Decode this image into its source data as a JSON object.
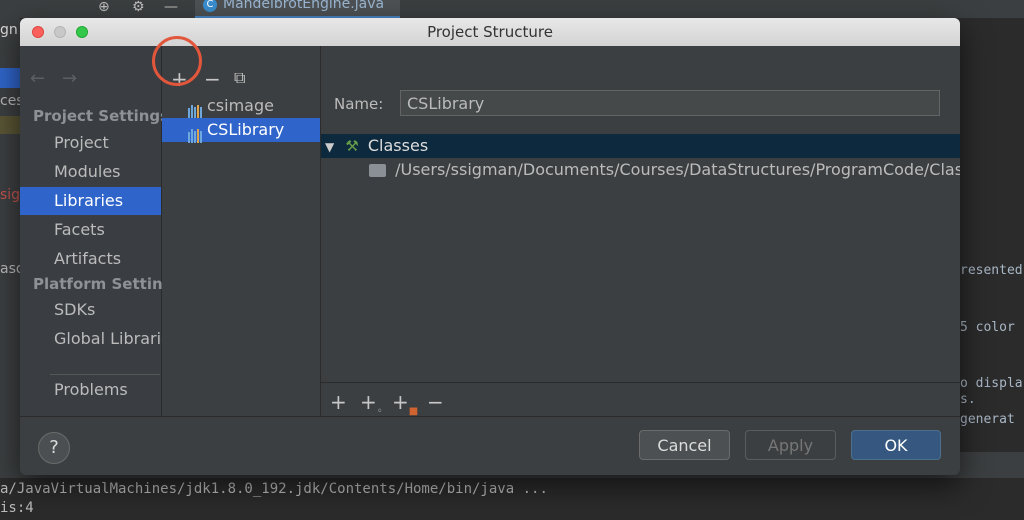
{
  "ide": {
    "editor_tab": "MandelbrotEngine.java",
    "editor_tab_icon": "C",
    "left_fragments": [
      "gn",
      "ces",
      "sig",
      "aso"
    ],
    "right_fragments": [
      "resented",
      "5 color",
      "o displa",
      "s.",
      "generat"
    ],
    "console_line1": "a/JavaVirtualMachines/jdk1.8.0_192.jdk/Contents/Home/bin/java ...",
    "console_line2": "is:4"
  },
  "dialog": {
    "title": "Project Structure",
    "sidebar": {
      "project_settings_heading": "Project Settings",
      "project_settings_items": [
        "Project",
        "Modules",
        "Libraries",
        "Facets",
        "Artifacts"
      ],
      "platform_settings_heading": "Platform Settings",
      "platform_settings_items": [
        "SDKs",
        "Global Libraries"
      ],
      "problems": "Problems",
      "selected": "Libraries"
    },
    "libraries": [
      {
        "name": "csimage",
        "selected": false
      },
      {
        "name": "CSLibrary",
        "selected": true
      }
    ],
    "toolbar_icons": [
      "plus-icon",
      "minus-icon",
      "copy-icon"
    ],
    "name_label": "Name:",
    "name_value": "CSLibrary",
    "tree": {
      "root": "Classes",
      "child": "/Users/ssigman/Documents/Courses/DataStructures/ProgramCode/ClassCode"
    },
    "content_tools": [
      "plus-icon",
      "add-jar-icon",
      "add-folder-icon",
      "minus-icon"
    ],
    "buttons": {
      "help": "?",
      "cancel": "Cancel",
      "apply": "Apply",
      "ok": "OK"
    },
    "colors": {
      "selection": "#2f65ca",
      "highlight_circle": "#e2563c",
      "ok_button": "#365880"
    }
  }
}
